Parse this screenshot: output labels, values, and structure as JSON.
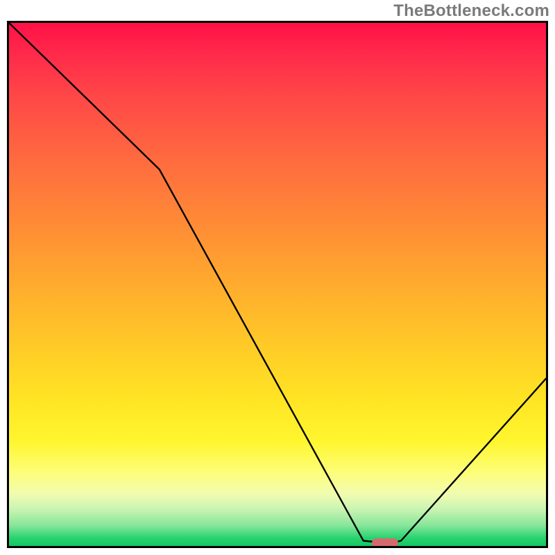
{
  "watermark": "TheBottleneck.com",
  "chart_data": {
    "type": "line",
    "title": "",
    "xlabel": "",
    "ylabel": "",
    "xlim": [
      0,
      100
    ],
    "ylim": [
      0,
      100
    ],
    "x": [
      0,
      28,
      66,
      71,
      73,
      100
    ],
    "values": [
      100,
      72,
      1,
      0.5,
      1,
      32
    ],
    "marker": {
      "x": 70,
      "y": 0.5
    },
    "gradient_stops": [
      {
        "offset": 0,
        "color": "#ff1147"
      },
      {
        "offset": 0.14,
        "color": "#ff4747"
      },
      {
        "offset": 0.38,
        "color": "#ff8a36"
      },
      {
        "offset": 0.62,
        "color": "#ffcb27"
      },
      {
        "offset": 0.8,
        "color": "#fff62e"
      },
      {
        "offset": 0.9,
        "color": "#f2fcb0"
      },
      {
        "offset": 0.96,
        "color": "#89e69b"
      },
      {
        "offset": 1.0,
        "color": "#14c861"
      }
    ]
  }
}
